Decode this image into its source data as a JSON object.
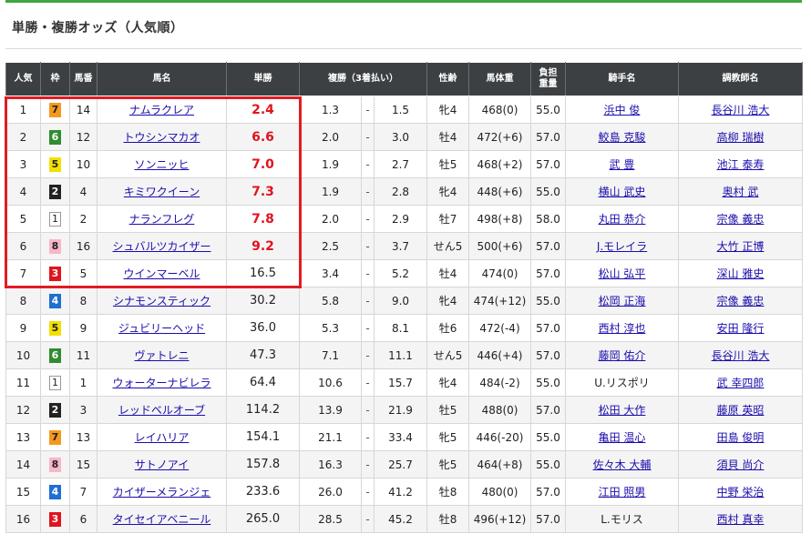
{
  "page": {
    "title": "単勝・複勝オッズ（人気順）"
  },
  "table": {
    "headers": {
      "rank": "人気",
      "waku": "枠",
      "num": "馬番",
      "horse": "馬名",
      "win": "単勝",
      "place": "複勝（3着払い）",
      "sexage": "性齢",
      "weight": "馬体重",
      "load_1": "負担",
      "load_2": "重量",
      "jockey": "騎手名",
      "trainer": "調教師名"
    },
    "separator": "-",
    "rows": [
      {
        "rank": "1",
        "waku": "7",
        "num": "14",
        "horse": "ナムラクレア",
        "win": "2.4",
        "pmin": "1.3",
        "pmax": "1.5",
        "sexage": "牝4",
        "weight": "468(0)",
        "load": "55.0",
        "jockey": "浜中 俊",
        "trainer": "長谷川 浩大"
      },
      {
        "rank": "2",
        "waku": "6",
        "num": "12",
        "horse": "トウシンマカオ",
        "win": "6.6",
        "pmin": "2.0",
        "pmax": "3.0",
        "sexage": "牡4",
        "weight": "472(+6)",
        "load": "57.0",
        "jockey": "鮫島 克駿",
        "trainer": "高柳 瑞樹"
      },
      {
        "rank": "3",
        "waku": "5",
        "num": "10",
        "horse": "ソンニッヒ",
        "win": "7.0",
        "pmin": "1.9",
        "pmax": "2.7",
        "sexage": "牡5",
        "weight": "468(+2)",
        "load": "57.0",
        "jockey": "武 豊",
        "trainer": "池江 泰寿"
      },
      {
        "rank": "4",
        "waku": "2",
        "num": "4",
        "horse": "キミワクイーン",
        "win": "7.3",
        "pmin": "1.9",
        "pmax": "2.8",
        "sexage": "牝4",
        "weight": "448(+6)",
        "load": "55.0",
        "jockey": "横山 武史",
        "trainer": "奥村 武"
      },
      {
        "rank": "5",
        "waku": "1",
        "num": "2",
        "horse": "ナランフレグ",
        "win": "7.8",
        "pmin": "2.0",
        "pmax": "2.9",
        "sexage": "牡7",
        "weight": "498(+8)",
        "load": "58.0",
        "jockey": "丸田 恭介",
        "trainer": "宗像 義忠"
      },
      {
        "rank": "6",
        "waku": "8",
        "num": "16",
        "horse": "シュバルツカイザー",
        "win": "9.2",
        "pmin": "2.5",
        "pmax": "3.7",
        "sexage": "せん5",
        "weight": "500(+6)",
        "load": "57.0",
        "jockey": "J.モレイラ",
        "trainer": "大竹 正博"
      },
      {
        "rank": "7",
        "waku": "3",
        "num": "5",
        "horse": "ウインマーベル",
        "win": "16.5",
        "pmin": "3.4",
        "pmax": "5.2",
        "sexage": "牡4",
        "weight": "474(0)",
        "load": "57.0",
        "jockey": "松山 弘平",
        "trainer": "深山 雅史"
      },
      {
        "rank": "8",
        "waku": "4",
        "num": "8",
        "horse": "シナモンスティック",
        "win": "30.2",
        "pmin": "5.8",
        "pmax": "9.0",
        "sexage": "牝4",
        "weight": "474(+12)",
        "load": "55.0",
        "jockey": "松岡 正海",
        "trainer": "宗像 義忠"
      },
      {
        "rank": "9",
        "waku": "5",
        "num": "9",
        "horse": "ジュビリーヘッド",
        "win": "36.0",
        "pmin": "5.3",
        "pmax": "8.1",
        "sexage": "牡6",
        "weight": "472(-4)",
        "load": "57.0",
        "jockey": "西村 淳也",
        "trainer": "安田 隆行"
      },
      {
        "rank": "10",
        "waku": "6",
        "num": "11",
        "horse": "ヴァトレニ",
        "win": "47.3",
        "pmin": "7.1",
        "pmax": "11.1",
        "sexage": "せん5",
        "weight": "446(+4)",
        "load": "57.0",
        "jockey": "藤岡 佑介",
        "trainer": "長谷川 浩大"
      },
      {
        "rank": "11",
        "waku": "1",
        "num": "1",
        "horse": "ウォーターナビレラ",
        "win": "64.4",
        "pmin": "10.6",
        "pmax": "15.7",
        "sexage": "牝4",
        "weight": "484(-2)",
        "load": "55.0",
        "jockey": "U.リスポリ",
        "trainer": "武 幸四郎"
      },
      {
        "rank": "12",
        "waku": "2",
        "num": "3",
        "horse": "レッドベルオーブ",
        "win": "114.2",
        "pmin": "13.9",
        "pmax": "21.9",
        "sexage": "牡5",
        "weight": "488(0)",
        "load": "57.0",
        "jockey": "松田 大作",
        "trainer": "藤原 英昭"
      },
      {
        "rank": "13",
        "waku": "7",
        "num": "13",
        "horse": "レイハリア",
        "win": "154.1",
        "pmin": "21.1",
        "pmax": "33.4",
        "sexage": "牝5",
        "weight": "446(-20)",
        "load": "55.0",
        "jockey": "亀田 温心",
        "trainer": "田島 俊明"
      },
      {
        "rank": "14",
        "waku": "8",
        "num": "15",
        "horse": "サトノアイ",
        "win": "157.8",
        "pmin": "16.3",
        "pmax": "25.7",
        "sexage": "牝5",
        "weight": "464(+8)",
        "load": "55.0",
        "jockey": "佐々木 大輔",
        "trainer": "須貝 尚介"
      },
      {
        "rank": "15",
        "waku": "4",
        "num": "7",
        "horse": "カイザーメランジェ",
        "win": "233.6",
        "pmin": "26.0",
        "pmax": "41.2",
        "sexage": "牡8",
        "weight": "480(0)",
        "load": "57.0",
        "jockey": "江田 照男",
        "trainer": "中野 栄治"
      },
      {
        "rank": "16",
        "waku": "3",
        "num": "6",
        "horse": "タイセイアベニール",
        "win": "265.0",
        "pmin": "28.5",
        "pmax": "45.2",
        "sexage": "牡8",
        "weight": "496(+12)",
        "load": "57.0",
        "jockey": "L.モリス",
        "trainer": "西村 真幸"
      }
    ],
    "hot_count": 6,
    "highlight_count": 7,
    "jockey_plain": [
      "U.リスポリ",
      "L.モリス"
    ]
  },
  "colors": {
    "header_bg": "#3c4043",
    "top_line": "#3fa53f",
    "highlight_border": "#e01c24",
    "hot_odds": "#e0141e",
    "link": "#1a0dab"
  }
}
